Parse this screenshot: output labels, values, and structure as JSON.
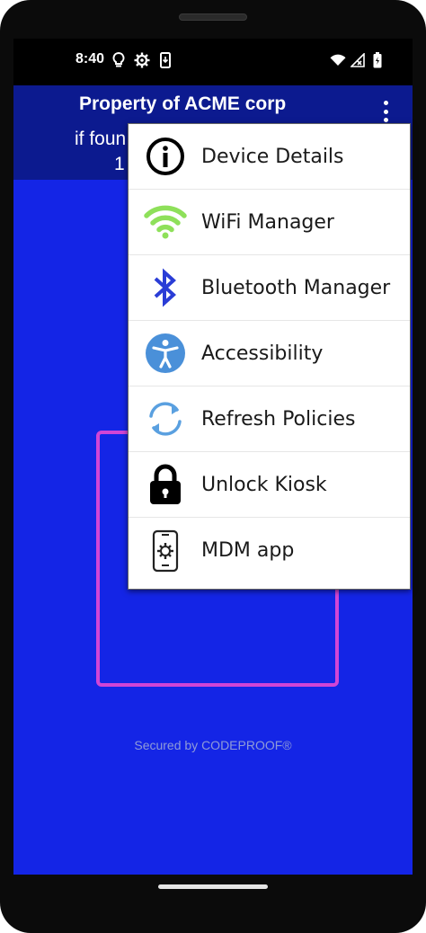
{
  "status_bar": {
    "time": "8:40",
    "left_icons": [
      "lightbulb-icon",
      "gear-icon",
      "download-icon"
    ],
    "right_icons": [
      "wifi-icon",
      "signal-icon",
      "battery-icon"
    ]
  },
  "app_bar": {
    "title": "Property of ACME corp",
    "subtitle_line1": "if foun",
    "subtitle_line2": "1"
  },
  "footer": {
    "secured_text": "Secured by CODEPROOF®"
  },
  "menu": {
    "items": [
      {
        "label": "Device Details",
        "icon": "info-icon"
      },
      {
        "label": "WiFi Manager",
        "icon": "wifi-icon"
      },
      {
        "label": "Bluetooth Manager",
        "icon": "bluetooth-icon"
      },
      {
        "label": "Accessibility",
        "icon": "accessibility-icon"
      },
      {
        "label": "Refresh Policies",
        "icon": "refresh-icon"
      },
      {
        "label": "Unlock Kiosk",
        "icon": "lock-icon"
      },
      {
        "label": "MDM app",
        "icon": "phone-settings-icon"
      }
    ]
  },
  "colors": {
    "screen_bg": "#1425e6",
    "app_bar_bg": "#0c1a8f",
    "kiosk_frame": "#d145d6",
    "wifi_green": "#8ee05a",
    "bluetooth_blue": "#2a3dd6",
    "accessibility_blue": "#4a90d9"
  }
}
